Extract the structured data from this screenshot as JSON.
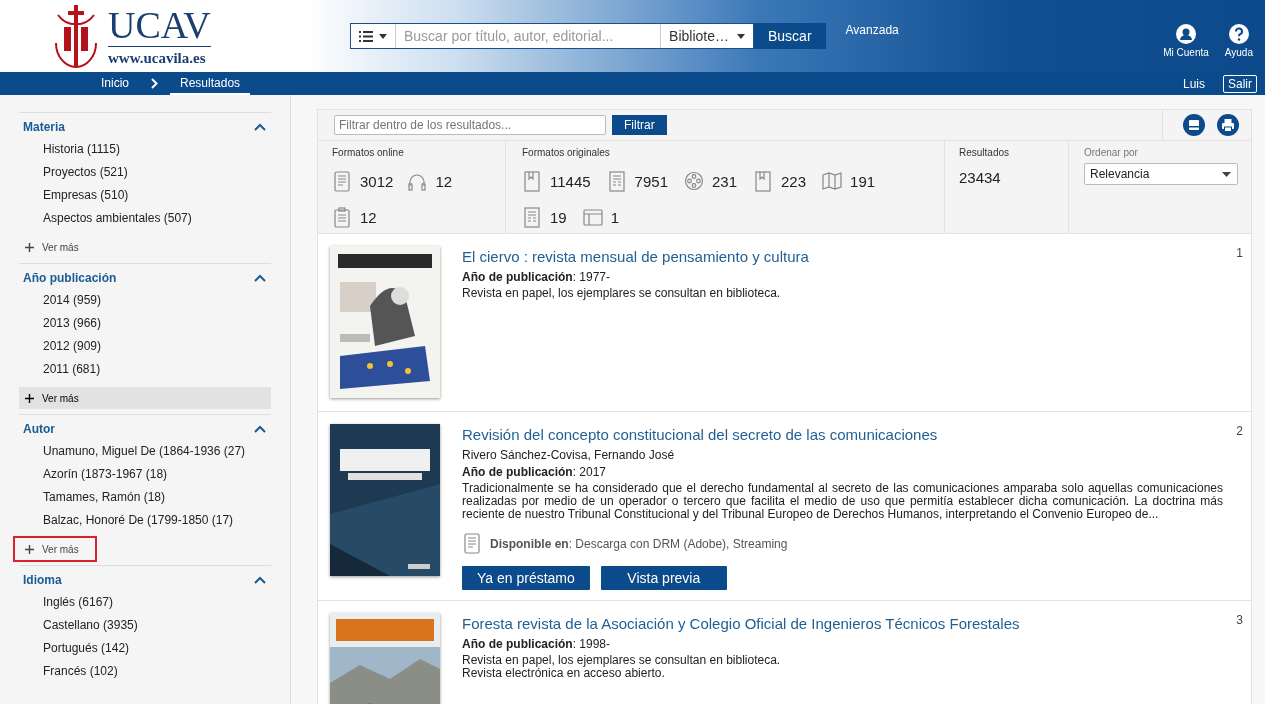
{
  "header": {
    "logo_text": "UCAV",
    "logo_url": "www.ucavila.es",
    "search": {
      "placeholder": "Buscar por título, autor, editorial...",
      "scope": "Bibliote…",
      "button": "Buscar"
    },
    "advanced_link": "Avanzada",
    "actions": [
      {
        "kind": "account",
        "label": "Mi Cuenta"
      },
      {
        "kind": "help",
        "label": "Ayuda"
      }
    ]
  },
  "breadcrumb": [
    {
      "label": "Inicio",
      "selected": false
    },
    {
      "label": "Resultados",
      "selected": true
    }
  ],
  "user": {
    "name": "Luis",
    "logout": "Salir"
  },
  "facets": [
    {
      "title": "Materia",
      "expanded": true,
      "items": [
        "Historia (1115)",
        "Proyectos (521)",
        "Empresas (510)",
        "Aspectos ambientales (507)"
      ],
      "more": {
        "label": "Ver más",
        "hovered": false,
        "outlined": false
      }
    },
    {
      "title": "Año publicación",
      "expanded": true,
      "items": [
        "2014 (959)",
        "2013 (966)",
        "2012 (909)",
        "2011 (681)"
      ],
      "more": {
        "label": "Ver más",
        "hovered": true,
        "outlined": false
      }
    },
    {
      "title": "Autor",
      "expanded": true,
      "items": [
        "Unamuno, Miguel De (1864-1936 (27)",
        "Azorín (1873-1967 (18)",
        "Tamames, Ramón (18)",
        "Balzac, Honoré De (1799-1850 (17)"
      ],
      "more": {
        "label": "Ver más",
        "hovered": false,
        "outlined": true
      }
    },
    {
      "title": "Idioma",
      "expanded": true,
      "items": [
        "Inglés (6167)",
        "Castellano (3935)",
        "Portugués (142)",
        "Francés (102)"
      ]
    }
  ],
  "filter": {
    "placeholder": "Filtrar dentro de los resultados...",
    "button": "Filtrar"
  },
  "tools": [
    {
      "kind": "save"
    },
    {
      "kind": "print"
    }
  ],
  "formats_online": {
    "title": "Formatos online",
    "items": [
      {
        "kind": "ebook",
        "count": "3012"
      },
      {
        "kind": "audio",
        "count": "12"
      },
      {
        "kind": "document",
        "count": "12"
      }
    ]
  },
  "formats_original": {
    "title": "Formatos originales",
    "items": [
      {
        "kind": "book",
        "count": "11445"
      },
      {
        "kind": "journal",
        "count": "7951"
      },
      {
        "kind": "film",
        "count": "231"
      },
      {
        "kind": "book",
        "count": "223"
      },
      {
        "kind": "map",
        "count": "191"
      },
      {
        "kind": "journal",
        "count": "19"
      },
      {
        "kind": "window",
        "count": "1"
      }
    ]
  },
  "results_count": {
    "title": "Resultados",
    "value": "23434"
  },
  "sort": {
    "title": "Ordenar por",
    "value": "Relevancia"
  },
  "results": [
    {
      "number": "1",
      "title": "El ciervo : revista mensual de pensamiento y cultura",
      "year": "**Año de publicación**: 1977-",
      "notes": [
        "Revista en papel, los ejemplares se consultan en biblioteca."
      ]
    },
    {
      "number": "2",
      "title": "Revisión del concepto constitucional del secreto de las comunicaciones",
      "author": "Rivero Sánchez-Covisa, Fernando José",
      "year": "**Año de publicación**: 2017",
      "abstract": "Tradicionalmente se ha considerado que el derecho fundamental al secreto de las comunicaciones amparaba solo aquellas comunicaciones realizadas por medio de un operador o tercero que facilita el medio de uso que permitía establecer dicha comunicación. La doctrina más reciente de nuestro Tribunal Constitucional y del Tribunal Europeo de Derechos Humanos, interpretando el Convenio Europeo de...",
      "availability": "**Disponible en**: Descarga con DRM (Adobe), Streaming",
      "buttons": [
        "Ya en préstamo",
        "Vista previa"
      ]
    },
    {
      "number": "3",
      "title": "Foresta revista de la Asociación y Colegio Oficial de Ingenieros Técnicos Forestales",
      "year": "**Año de publicación**: 1998-",
      "notes": [
        "Revista en papel, los ejemplares se consultan en biblioteca.",
        "Revista electrónica en acceso abierto."
      ]
    }
  ]
}
